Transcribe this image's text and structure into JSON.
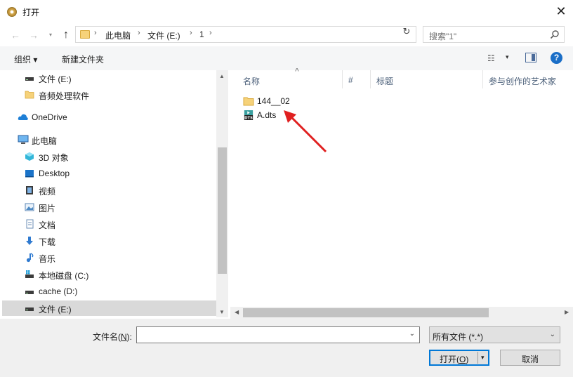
{
  "window": {
    "title": "打开",
    "close_glyph": "✕"
  },
  "nav": {
    "back_glyph": "←",
    "forward_glyph": "→",
    "recent_glyph": "▾",
    "up_glyph": "↑",
    "breadcrumb": [
      "此电脑",
      "文件 (E:)",
      "1"
    ],
    "sep_glyph": "›",
    "refresh_glyph": "↻",
    "dropdown_glyph": "⌄",
    "search_placeholder": "搜索\"1\""
  },
  "toolbar": {
    "organize_label": "组织 ▾",
    "new_folder_label": "新建文件夹",
    "view_glyph": "☷",
    "view_dd_glyph": "▾",
    "help_glyph": "?"
  },
  "sidebar": {
    "items": [
      {
        "label": "文件 (E:)",
        "icon": "drive-icon",
        "indent": 1,
        "selected": false
      },
      {
        "label": "音频处理软件",
        "icon": "folder-icon",
        "indent": 1,
        "selected": false
      },
      {
        "label": "OneDrive",
        "icon": "cloud-icon",
        "indent": 0,
        "selected": false
      },
      {
        "label": "此电脑",
        "icon": "computer-icon",
        "indent": 0,
        "selected": false
      },
      {
        "label": "3D 对象",
        "icon": "cube-icon",
        "indent": 1,
        "selected": false
      },
      {
        "label": "Desktop",
        "icon": "desktop-icon",
        "indent": 1,
        "selected": false
      },
      {
        "label": "视频",
        "icon": "video-icon",
        "indent": 1,
        "selected": false
      },
      {
        "label": "图片",
        "icon": "picture-icon",
        "indent": 1,
        "selected": false
      },
      {
        "label": "文档",
        "icon": "document-icon",
        "indent": 1,
        "selected": false
      },
      {
        "label": "下载",
        "icon": "download-icon",
        "indent": 1,
        "selected": false
      },
      {
        "label": "音乐",
        "icon": "music-icon",
        "indent": 1,
        "selected": false
      },
      {
        "label": "本地磁盘 (C:)",
        "icon": "windows-drive-icon",
        "indent": 1,
        "selected": false
      },
      {
        "label": "cache (D:)",
        "icon": "drive-icon",
        "indent": 1,
        "selected": false
      },
      {
        "label": "文件 (E:)",
        "icon": "drive-icon",
        "indent": 1,
        "selected": true
      }
    ]
  },
  "columns": [
    {
      "label": "名称"
    },
    {
      "label": "#"
    },
    {
      "label": "标题"
    },
    {
      "label": "参与创作的艺术家"
    }
  ],
  "sort_glyph": "^",
  "files": [
    {
      "name": "144__02",
      "type": "folder-icon"
    },
    {
      "name": "A.dts",
      "type": "dts-file-icon"
    }
  ],
  "scroll": {
    "up": "▲",
    "down": "▼",
    "left": "◀",
    "right": "▶"
  },
  "bottom": {
    "filename_label_prefix": "文件名(",
    "filename_label_key": "N",
    "filename_label_suffix": "):",
    "filename_value": "",
    "filetype_value": "所有文件 (*.*)",
    "open_label_prefix": "打开(",
    "open_label_key": "O",
    "open_label_suffix": ")",
    "split_glyph": "▾",
    "cancel_label": "取消"
  },
  "colors": {
    "annotation_arrow": "#e02020",
    "selection": "#d9d9d9",
    "accent": "#0078d7"
  }
}
